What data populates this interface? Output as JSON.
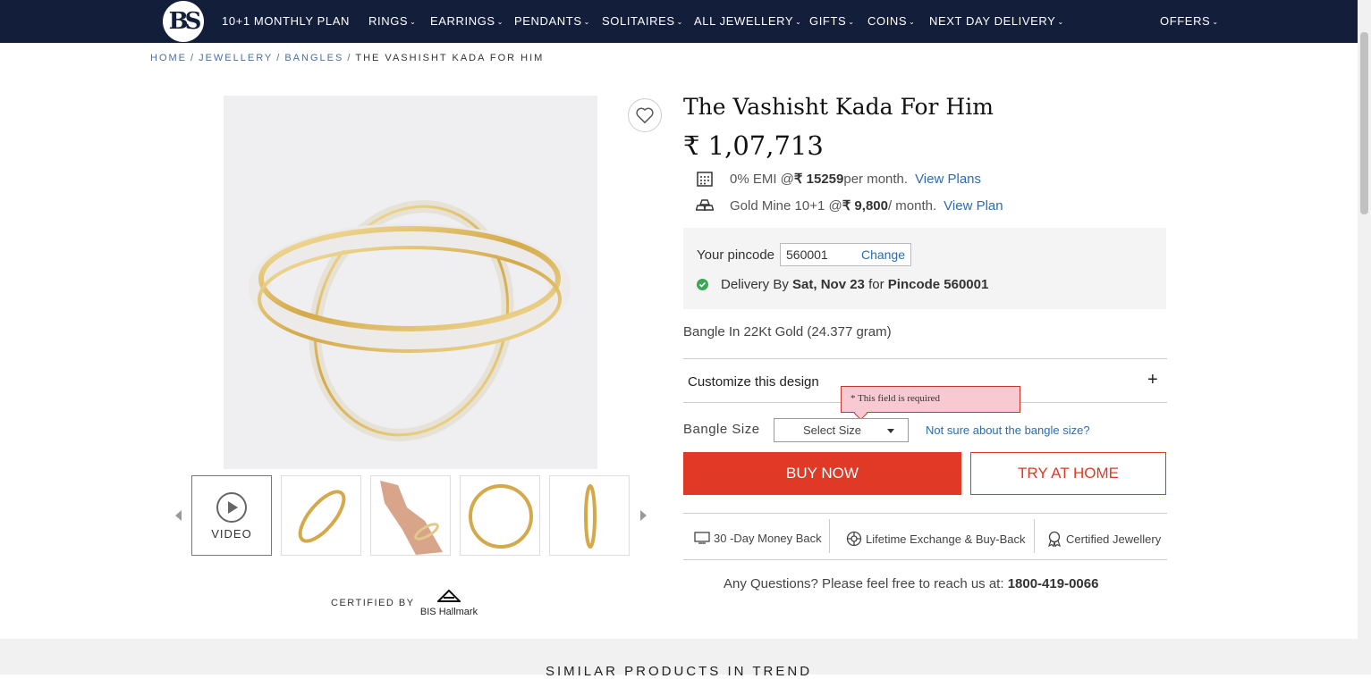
{
  "header": {
    "logo_text": "BS",
    "nav": [
      {
        "label": "10+1 MONTHLY PLAN",
        "dropdown": false
      },
      {
        "label": "RINGS",
        "dropdown": true
      },
      {
        "label": "EARRINGS",
        "dropdown": true
      },
      {
        "label": "PENDANTS",
        "dropdown": true
      },
      {
        "label": "SOLITAIRES",
        "dropdown": true
      },
      {
        "label": "ALL JEWELLERY",
        "dropdown": true
      },
      {
        "label": "GIFTS",
        "dropdown": true
      },
      {
        "label": "COINS",
        "dropdown": true
      },
      {
        "label": "NEXT DAY DELIVERY",
        "dropdown": true
      }
    ],
    "offers": "OFFERS",
    "bg_color": "#131e3a"
  },
  "breadcrumb": {
    "items": [
      "HOME",
      "JEWELLERY",
      "BANGLES"
    ],
    "current": "THE VASHISHT KADA FOR HIM"
  },
  "gallery": {
    "video_label": "VIDEO",
    "certified_by": "CERTIFIED BY",
    "hallmark": "BIS Hallmark"
  },
  "product": {
    "title": "The Vashisht Kada For Him",
    "price": "₹ 1,07,713",
    "emi": {
      "prefix": "0% EMI @ ",
      "amount": "₹ 15259",
      "suffix": " per month.",
      "link": "View Plans"
    },
    "goldmine": {
      "prefix": "Gold Mine 10+1 @ ",
      "amount": "₹ 9,800",
      "suffix": " / month.",
      "link": "View Plan"
    },
    "pincode": {
      "label": "Your pincode",
      "value": "560001",
      "change": "Change"
    },
    "delivery": {
      "prefix": "Delivery By ",
      "date": "Sat, Nov 23",
      "mid": " for ",
      "pincode": "Pincode 560001"
    },
    "metal": "Bangle In 22Kt Gold (24.377 gram)",
    "customize": "Customize this design",
    "error_tooltip": "* This field is required",
    "size": {
      "label": "Bangle Size",
      "selected": "Select Size",
      "help": "Not sure about the bangle size?"
    },
    "buy_now": "BUY NOW",
    "try_at_home": "TRY AT HOME",
    "assurances": [
      "30 -Day Money Back",
      "Lifetime Exchange & Buy-Back",
      "Certified Jewellery"
    ],
    "questions": {
      "prefix": "Any Questions? Please feel free to reach us at: ",
      "phone": "1800-419-0066"
    },
    "accent_color": "#e03a26",
    "link_color": "#2b6cb0"
  },
  "similar": {
    "title": "SIMILAR PRODUCTS IN TREND"
  }
}
